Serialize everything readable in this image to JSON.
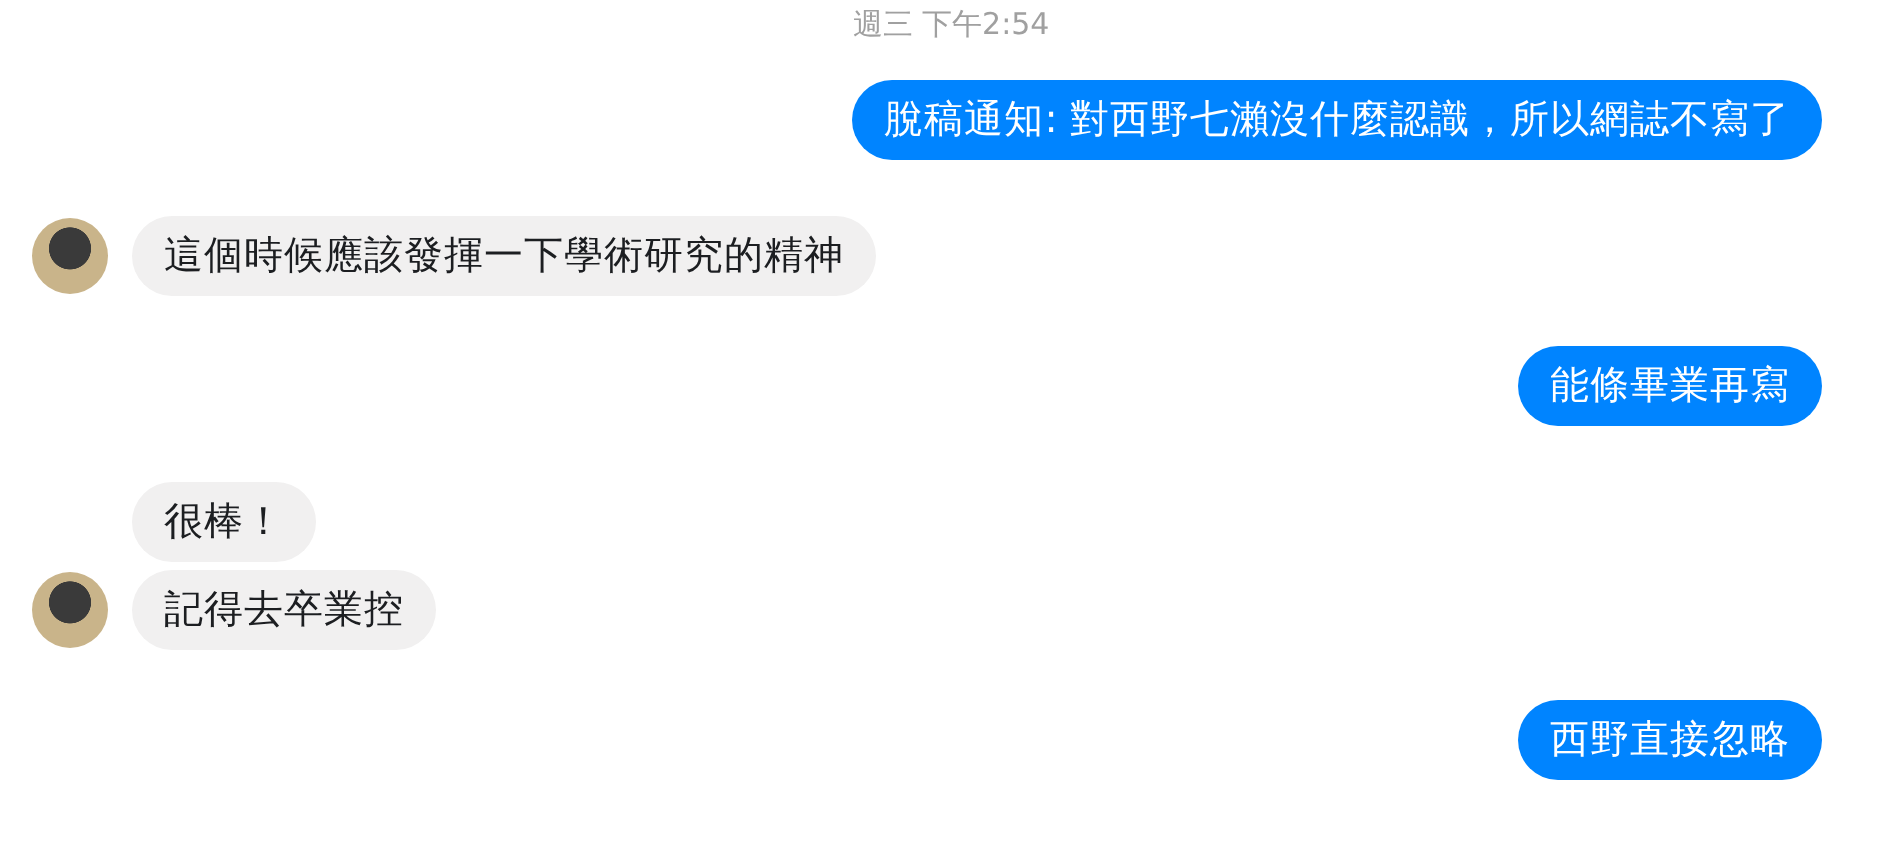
{
  "timestamp": "週三 下午2:54",
  "groups": [
    {
      "kind": "sent",
      "bubbles": [
        "脫稿通知: 對西野七瀨沒什麼認識，所以網誌不寫了"
      ]
    },
    {
      "kind": "received",
      "bubbles": [
        "這個時候應該發揮一下學術研究的精神"
      ]
    },
    {
      "kind": "sent",
      "bubbles": [
        "能條畢業再寫"
      ]
    },
    {
      "kind": "received",
      "bubbles": [
        "很棒！",
        "記得去卒業控"
      ]
    },
    {
      "kind": "sent",
      "bubbles": [
        "西野直接忽略"
      ]
    }
  ]
}
